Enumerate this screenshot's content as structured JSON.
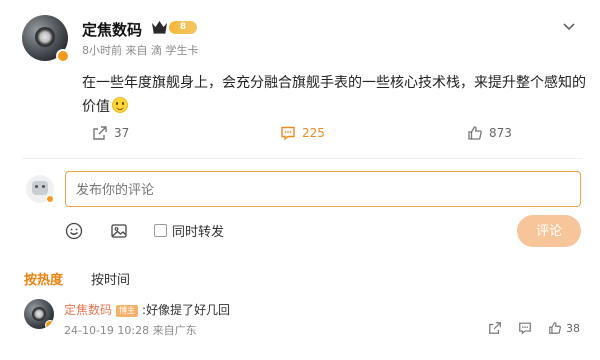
{
  "post": {
    "author": "定焦数码",
    "level_badge": "8",
    "meta": "8小时前 来自 滴 学生卡",
    "text": "在一些年度旗舰身上，会充分融合旗舰手表的一些核心技术栈，来提升整个感知的价值"
  },
  "actions": {
    "repost_count": "37",
    "comment_count": "225",
    "like_count": "873"
  },
  "comment_box": {
    "placeholder": "发布你的评论",
    "repost_label": "同时转发",
    "submit_label": "评论"
  },
  "sort_tabs": {
    "hot": "按热度",
    "time": "按时间"
  },
  "reply": {
    "user": "定焦数码",
    "badge": "博主",
    "text": ":好像提了好几回",
    "meta": "24-10-19 10:28 来自广东",
    "like_count": "38"
  },
  "colors": {
    "accent": "#f0820f",
    "input_border": "#f5a24a",
    "submit_bg": "#f8c59a"
  },
  "icons": [
    "chevron-down-icon",
    "crown-icon",
    "repost-icon",
    "comment-icon",
    "like-icon",
    "emoji-icon",
    "image-icon"
  ]
}
